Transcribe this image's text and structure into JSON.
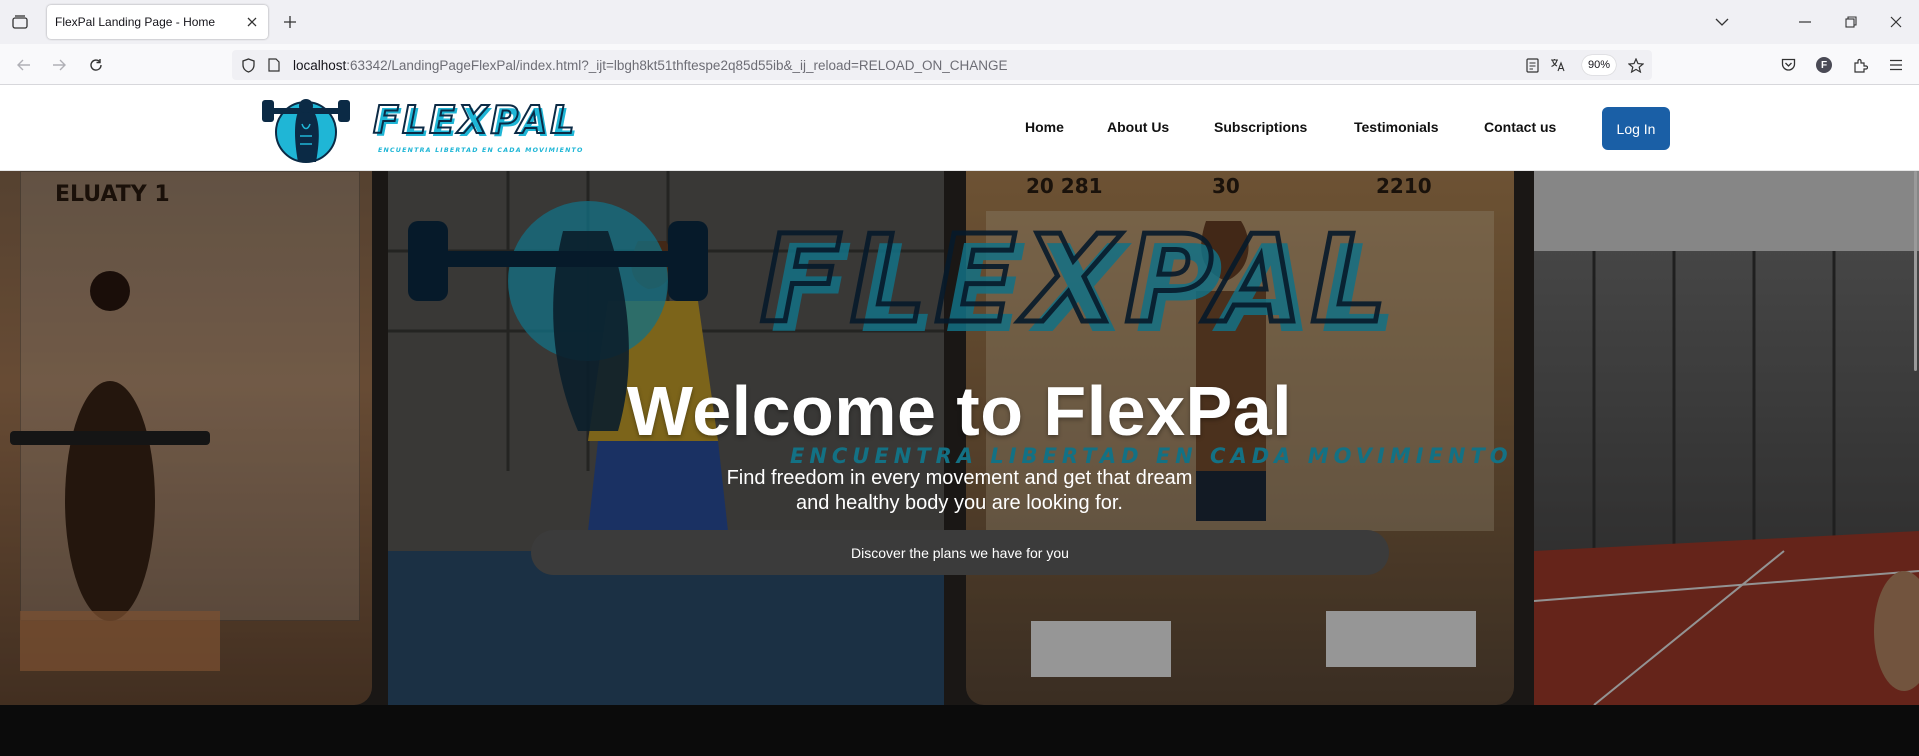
{
  "browser": {
    "tab_title": "FlexPal Landing Page - Home",
    "url_host": "localhost",
    "url_rest": ":63342/LandingPageFlexPal/index.html?_ijt=lbgh8kt51thftespe2q85d55ib&_ij_reload=RELOAD_ON_CHANGE",
    "zoom": "90%",
    "profile_initial": "F"
  },
  "header": {
    "logo_alt": "FLEXPAL",
    "logo_tagline": "ENCUENTRA LIBERTAD EN CADA MOVIMIENTO",
    "nav": [
      {
        "label": "Home"
      },
      {
        "label": "About Us"
      },
      {
        "label": "Subscriptions"
      },
      {
        "label": "Testimonials"
      },
      {
        "label": "Contact us"
      }
    ],
    "login_label": "Log In"
  },
  "hero": {
    "title": "Welcome to FlexPal",
    "subtitle_line1": "Find freedom in every movement and get that dream",
    "subtitle_line2": "and healthy body you are looking for.",
    "cta_label": "Discover the plans we have for you",
    "image_text": {
      "calendar_1": "ELUATY 1",
      "calendar_2": "20 281",
      "calendar_3": "30",
      "calendar_4": "2210",
      "brand": "FLEXPAL",
      "brand_tagline": "ENCUENTRA LIBERTAD EN CADA MOVIMIENTO"
    }
  },
  "colors": {
    "login_bg": "#1a5fa6",
    "cta_bg": "#3b3b3b",
    "brand_teal": "#1fb6d6",
    "brand_navy": "#0b2a45"
  }
}
